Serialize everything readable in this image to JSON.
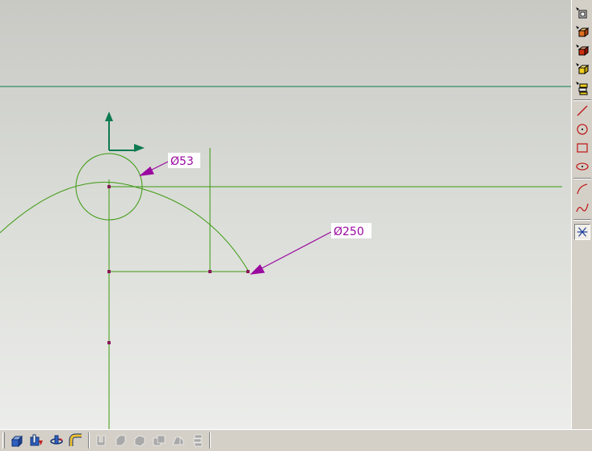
{
  "sketch": {
    "dimensions": [
      {
        "label": "Ø53"
      },
      {
        "label": "Ø250"
      }
    ]
  },
  "colors": {
    "geometry": "#3b9a10",
    "dimension": "#9a0aa0",
    "coord_arrows": "#0e7a52",
    "horizon_line": "#127a4e"
  },
  "right_toolbar": {
    "tools": [
      "insert-component-icon",
      "box-icon",
      "box-red-icon",
      "box-yellow-icon",
      "stack-icon",
      "line-icon",
      "circle-icon",
      "rectangle-icon",
      "ellipse-icon",
      "arc-icon",
      "spline-icon",
      "trim-icon"
    ],
    "active_tool": "trim-icon"
  },
  "bottom_toolbar": {
    "tools": [
      "extrude-icon",
      "extrude-cut-icon",
      "revolve-icon",
      "sweep-icon",
      "fillet-disabled-icon",
      "chamfer-disabled-icon",
      "shell-disabled-icon",
      "pattern-disabled-icon",
      "mirror-disabled-icon",
      "draft-disabled-icon"
    ]
  }
}
